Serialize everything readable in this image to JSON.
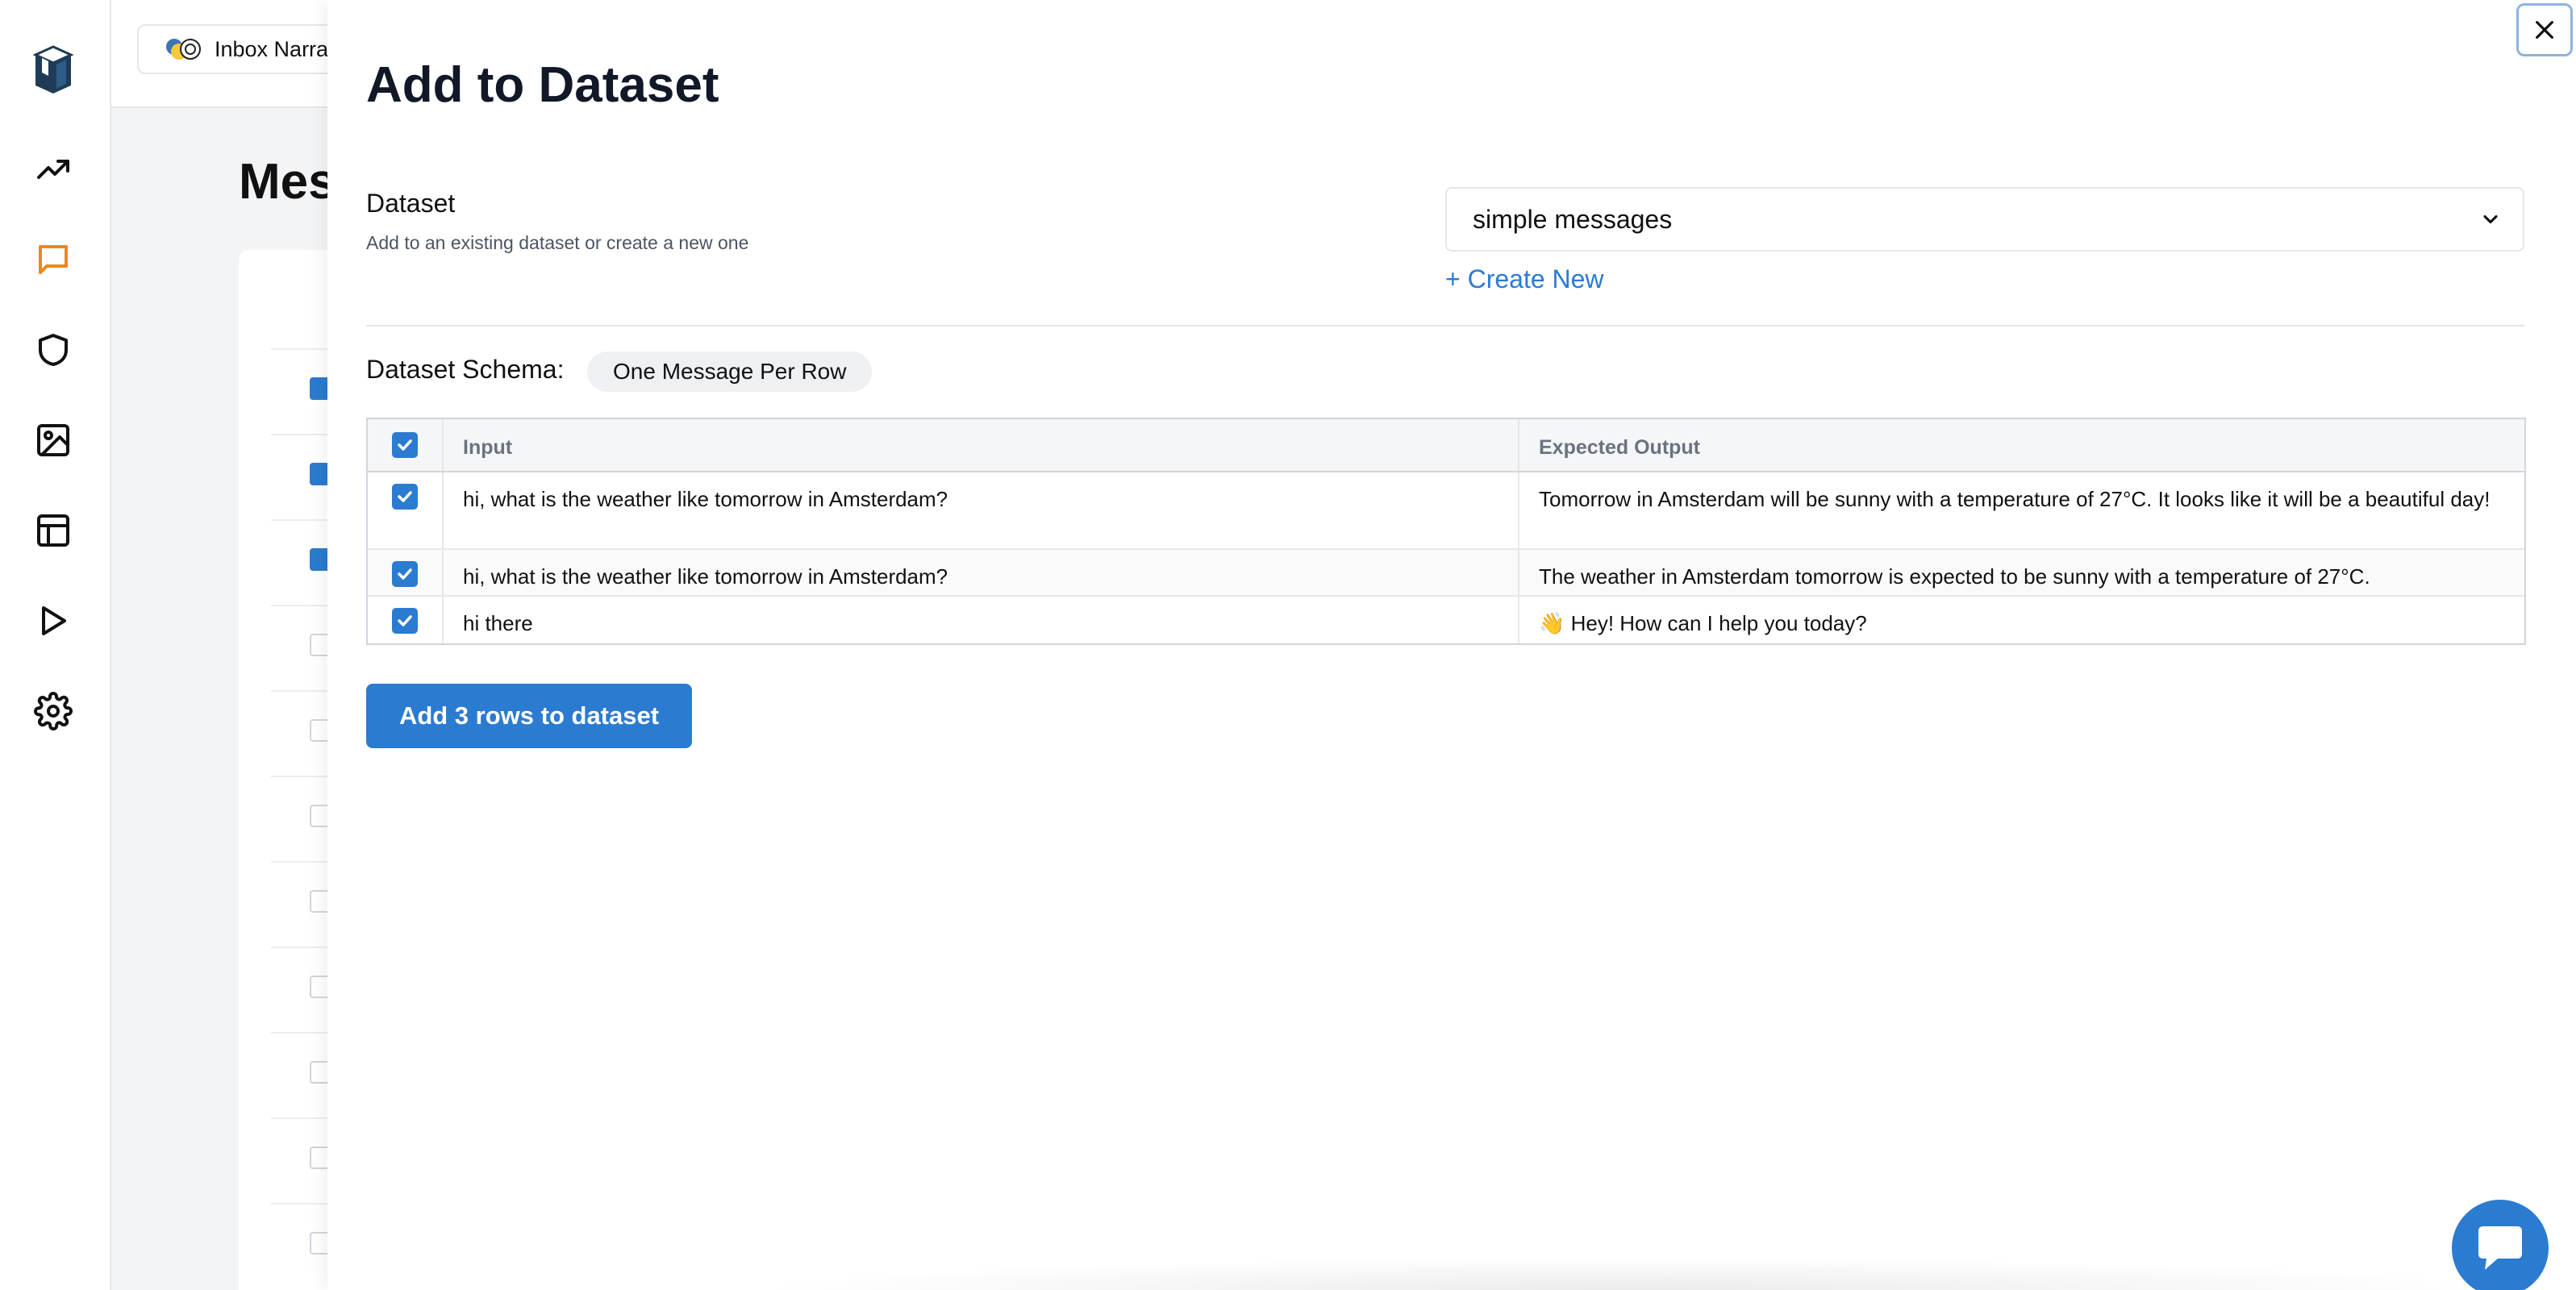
{
  "sidebar": {
    "items": [
      {
        "icon": "trending-up-icon"
      },
      {
        "icon": "message-icon",
        "active": true
      },
      {
        "icon": "shield-icon"
      },
      {
        "icon": "image-icon"
      },
      {
        "icon": "table-icon"
      },
      {
        "icon": "play-icon"
      },
      {
        "icon": "settings-icon"
      }
    ],
    "active_color": "#e8891c"
  },
  "header": {
    "project_name": "Inbox Narra"
  },
  "page": {
    "title": "Mes"
  },
  "modal": {
    "title": "Add to Dataset",
    "dataset_label": "Dataset",
    "dataset_help": "Add to an existing dataset or create a new one",
    "dataset_selected": "simple messages",
    "create_new": "+ Create New",
    "schema_label": "Dataset Schema:",
    "schema_value": "One Message Per Row",
    "table": {
      "columns": [
        "Input",
        "Expected Output"
      ],
      "rows": [
        {
          "checked": true,
          "input": "hi, what is the weather like tomorrow in Amsterdam?",
          "output": "Tomorrow in Amsterdam will be sunny with a temperature of 27°C. It looks like it will be a beautiful day!"
        },
        {
          "checked": true,
          "input": "hi, what is the weather like tomorrow in Amsterdam?",
          "output": "The weather in Amsterdam tomorrow is expected to be sunny with a temperature of 27°C."
        },
        {
          "checked": true,
          "input": "hi there",
          "output": "👋 Hey! How can I help you today?"
        }
      ]
    },
    "submit_label": "Add 3 rows to dataset"
  },
  "colors": {
    "accent": "#2b7bd0",
    "close_border": "#8db4de"
  }
}
